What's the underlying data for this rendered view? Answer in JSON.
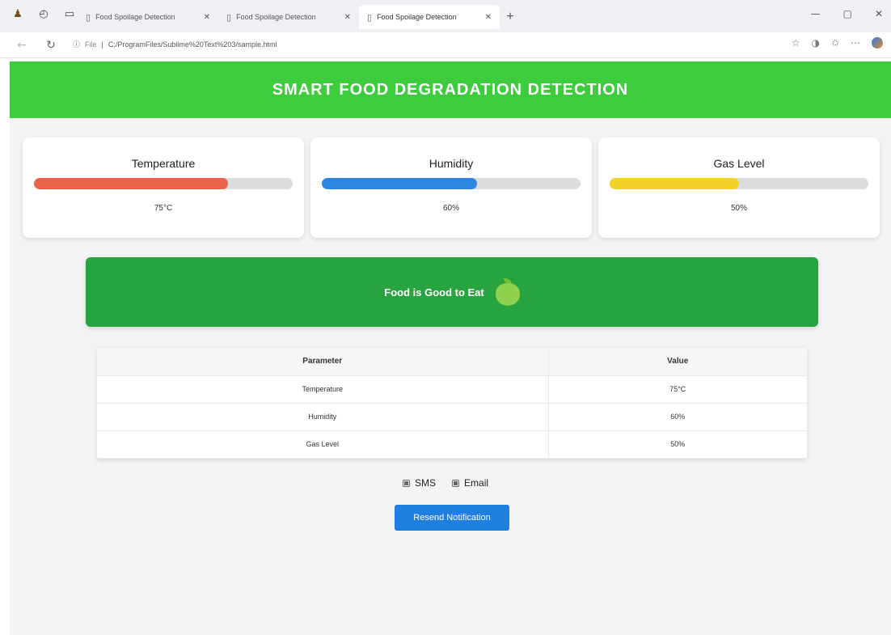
{
  "browser": {
    "tabs": [
      {
        "title": "Food Spoilage Detection"
      },
      {
        "title": "Food Spoilage Detection"
      },
      {
        "title": "Food Spoilage Detection",
        "active": true
      }
    ],
    "new_tab": "+",
    "url_prefix": "File",
    "url": "C:/ProgramFiles/Sublime%20Text%203/sample.html"
  },
  "header": {
    "title": "SMART FOOD DEGRADATION DETECTION",
    "color": "#3ccc3c"
  },
  "cards": [
    {
      "label": "Temperature",
      "value": "75°C",
      "level_percent": 75,
      "color": "#e8634a"
    },
    {
      "label": "Humidity",
      "value": "60%",
      "level_percent": 60,
      "color": "#2f86e0"
    },
    {
      "label": "Gas Level",
      "value": "50%",
      "level_percent": 50,
      "color": "#f2d226"
    }
  ],
  "status": {
    "text": "Food is Good to Eat",
    "color": "#27a340"
  },
  "table": {
    "headers": [
      "Parameter",
      "Value"
    ],
    "rows": [
      [
        "Temperature",
        "75°C"
      ],
      [
        "Humidity",
        "60%"
      ],
      [
        "Gas Level",
        "50%"
      ]
    ]
  },
  "notifications": {
    "sms_label": "SMS",
    "email_label": "Email",
    "resend_label": "Resend Notification",
    "button_color": "#1f7fe0"
  }
}
